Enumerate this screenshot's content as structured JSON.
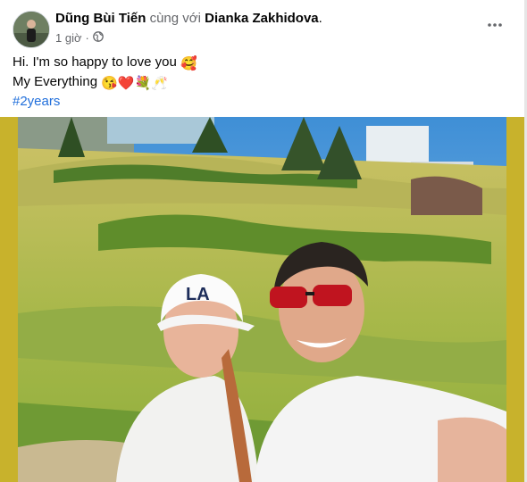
{
  "post": {
    "author": "Dũng Bùi Tiến",
    "with_text": "cùng với",
    "tagged_user": "Dianka Zakhidova",
    "timestamp": "1 giờ",
    "audience_icon": "globe-icon",
    "more_icon": "more-options-icon",
    "caption_line1": "Hi. I'm so happy to love you",
    "caption_line1_emoji": "🥰",
    "caption_line2": "My Everything",
    "caption_line2_emojis": "😘❤️💐🥂",
    "hashtag": "#2years"
  },
  "colors": {
    "hashtag": "#216fdb",
    "photo_border": "#c8b22c",
    "meta_text": "#65676b"
  }
}
